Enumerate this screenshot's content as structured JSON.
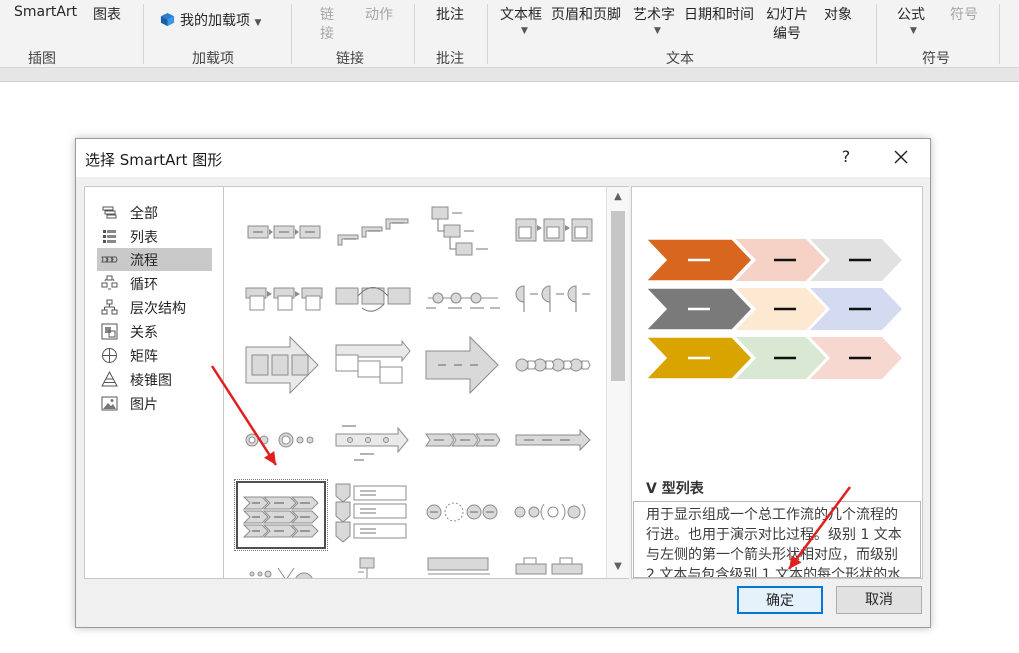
{
  "ribbon": {
    "buttons": {
      "smartart": "SmartArt",
      "chart": "图表",
      "my_addins": "我的加载项",
      "link_top": "链",
      "link_bottom": "接",
      "action": "动作",
      "comment": "批注",
      "textbox": "文本框",
      "header_footer": "页眉和页脚",
      "wordart": "艺术字",
      "datetime": "日期和时间",
      "slide_number_top": "幻灯片",
      "slide_number_bottom": "编号",
      "object": "对象",
      "equation": "公式",
      "symbol": "符号"
    },
    "groups": {
      "illustrations": "插图",
      "addins": "加载项",
      "links": "链接",
      "comments": "批注",
      "text": "文本",
      "symbols": "符号"
    }
  },
  "dialog": {
    "title": "选择 SmartArt 图形",
    "help": "?",
    "categories": [
      {
        "label": "全部",
        "icon": "all-icon"
      },
      {
        "label": "列表",
        "icon": "list-icon"
      },
      {
        "label": "流程",
        "icon": "process-icon",
        "selected": true
      },
      {
        "label": "循环",
        "icon": "cycle-icon"
      },
      {
        "label": "层次结构",
        "icon": "hierarchy-icon"
      },
      {
        "label": "关系",
        "icon": "relationship-icon"
      },
      {
        "label": "矩阵",
        "icon": "matrix-icon"
      },
      {
        "label": "棱锥图",
        "icon": "pyramid-icon"
      },
      {
        "label": "图片",
        "icon": "picture-icon"
      }
    ],
    "preview": {
      "name": "V 型列表",
      "description": "用于显示组成一个总工作流的几个流程的行进。也用于演示对比过程。级别 1 文本与左侧的第一个箭头形状相对应，而级别 2 文本与包含级别 1 文本的每个形状的水平子步骤相对应。",
      "rows": [
        {
          "dark": "#d8661e",
          "light1": "#f6d2c6",
          "light2": "#e1e1e1"
        },
        {
          "dark": "#7a7a7a",
          "light1": "#fde8d2",
          "light2": "#d4daf0"
        },
        {
          "dark": "#d9a400",
          "light1": "#d9e8d3",
          "light2": "#f6d8d0"
        }
      ]
    },
    "ok": "确定",
    "cancel": "取消"
  },
  "colors": {
    "annotation_arrow": "#e02020",
    "ok_border": "#0078d7"
  }
}
